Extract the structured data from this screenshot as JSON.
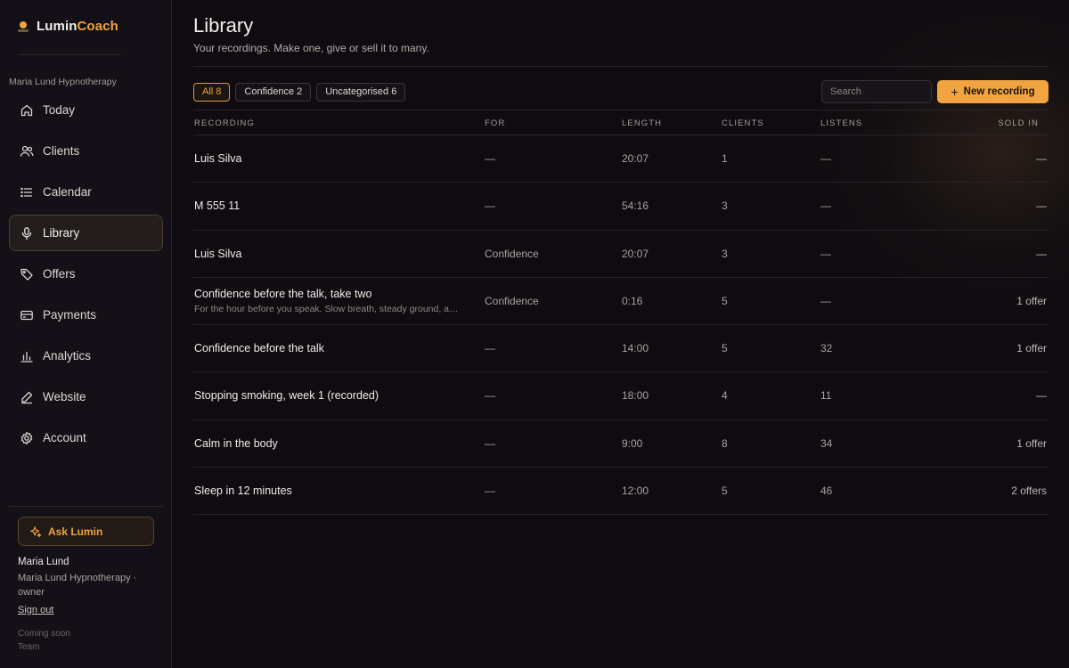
{
  "brand": {
    "part1": "Lumin",
    "part2": "Coach"
  },
  "org_label": "Maria Lund Hypnotherapy",
  "nav": [
    {
      "label": "Today",
      "icon": "home-icon",
      "active": false
    },
    {
      "label": "Clients",
      "icon": "users-icon",
      "active": false
    },
    {
      "label": "Calendar",
      "icon": "list-icon",
      "active": false
    },
    {
      "label": "Library",
      "icon": "microphone-icon",
      "active": true
    },
    {
      "label": "Offers",
      "icon": "tag-icon",
      "active": false
    },
    {
      "label": "Payments",
      "icon": "card-icon",
      "active": false
    },
    {
      "label": "Analytics",
      "icon": "bar-chart-icon",
      "active": false
    },
    {
      "label": "Website",
      "icon": "pen-icon",
      "active": false
    },
    {
      "label": "Account",
      "icon": "gear-icon",
      "active": false
    }
  ],
  "ask_label": "Ask Lumin",
  "user": {
    "name": "Maria Lund",
    "role": "Maria Lund Hypnotherapy · owner",
    "signout": "Sign out"
  },
  "coming_soon": {
    "label": "Coming soon",
    "item": "Team"
  },
  "page": {
    "title": "Library",
    "subtitle": "Your recordings. Make one, give or sell it to many."
  },
  "filters": [
    {
      "label": "All 8",
      "active": true
    },
    {
      "label": "Confidence 2",
      "active": false
    },
    {
      "label": "Uncategorised 6",
      "active": false
    }
  ],
  "search": {
    "placeholder": "Search",
    "value": ""
  },
  "new_button": {
    "label": "New recording",
    "plus": "+"
  },
  "table": {
    "columns": [
      "RECORDING",
      "FOR",
      "LENGTH",
      "CLIENTS",
      "LISTENS",
      "SOLD IN"
    ],
    "rows": [
      {
        "title": "Luis Silva",
        "desc": "",
        "for": "—",
        "length": "20:07",
        "clients": "1",
        "listens": "—",
        "sold": "—"
      },
      {
        "title": "M 555 11",
        "desc": "",
        "for": "—",
        "length": "54:16",
        "clients": "3",
        "listens": "—",
        "sold": "—"
      },
      {
        "title": "Luis Silva",
        "desc": "",
        "for": "Confidence",
        "length": "20:07",
        "clients": "3",
        "listens": "—",
        "sold": "—"
      },
      {
        "title": "Confidence before the talk, take two",
        "desc": "For the hour before you speak. Slow breath, steady ground, a…",
        "for": "Confidence",
        "length": "0:16",
        "clients": "5",
        "listens": "—",
        "sold": "1 offer"
      },
      {
        "title": "Confidence before the talk",
        "desc": "",
        "for": "—",
        "length": "14:00",
        "clients": "5",
        "listens": "32",
        "sold": "1 offer"
      },
      {
        "title": "Stopping smoking, week 1 (recorded)",
        "desc": "",
        "for": "—",
        "length": "18:00",
        "clients": "4",
        "listens": "11",
        "sold": "—"
      },
      {
        "title": "Calm in the body",
        "desc": "",
        "for": "—",
        "length": "9:00",
        "clients": "8",
        "listens": "34",
        "sold": "1 offer"
      },
      {
        "title": "Sleep in 12 minutes",
        "desc": "",
        "for": "—",
        "length": "12:00",
        "clients": "5",
        "listens": "46",
        "sold": "2 offers"
      }
    ]
  },
  "colors": {
    "accent": "#f0a43a",
    "background": "#0e0c10",
    "sidebar": "#131117"
  }
}
